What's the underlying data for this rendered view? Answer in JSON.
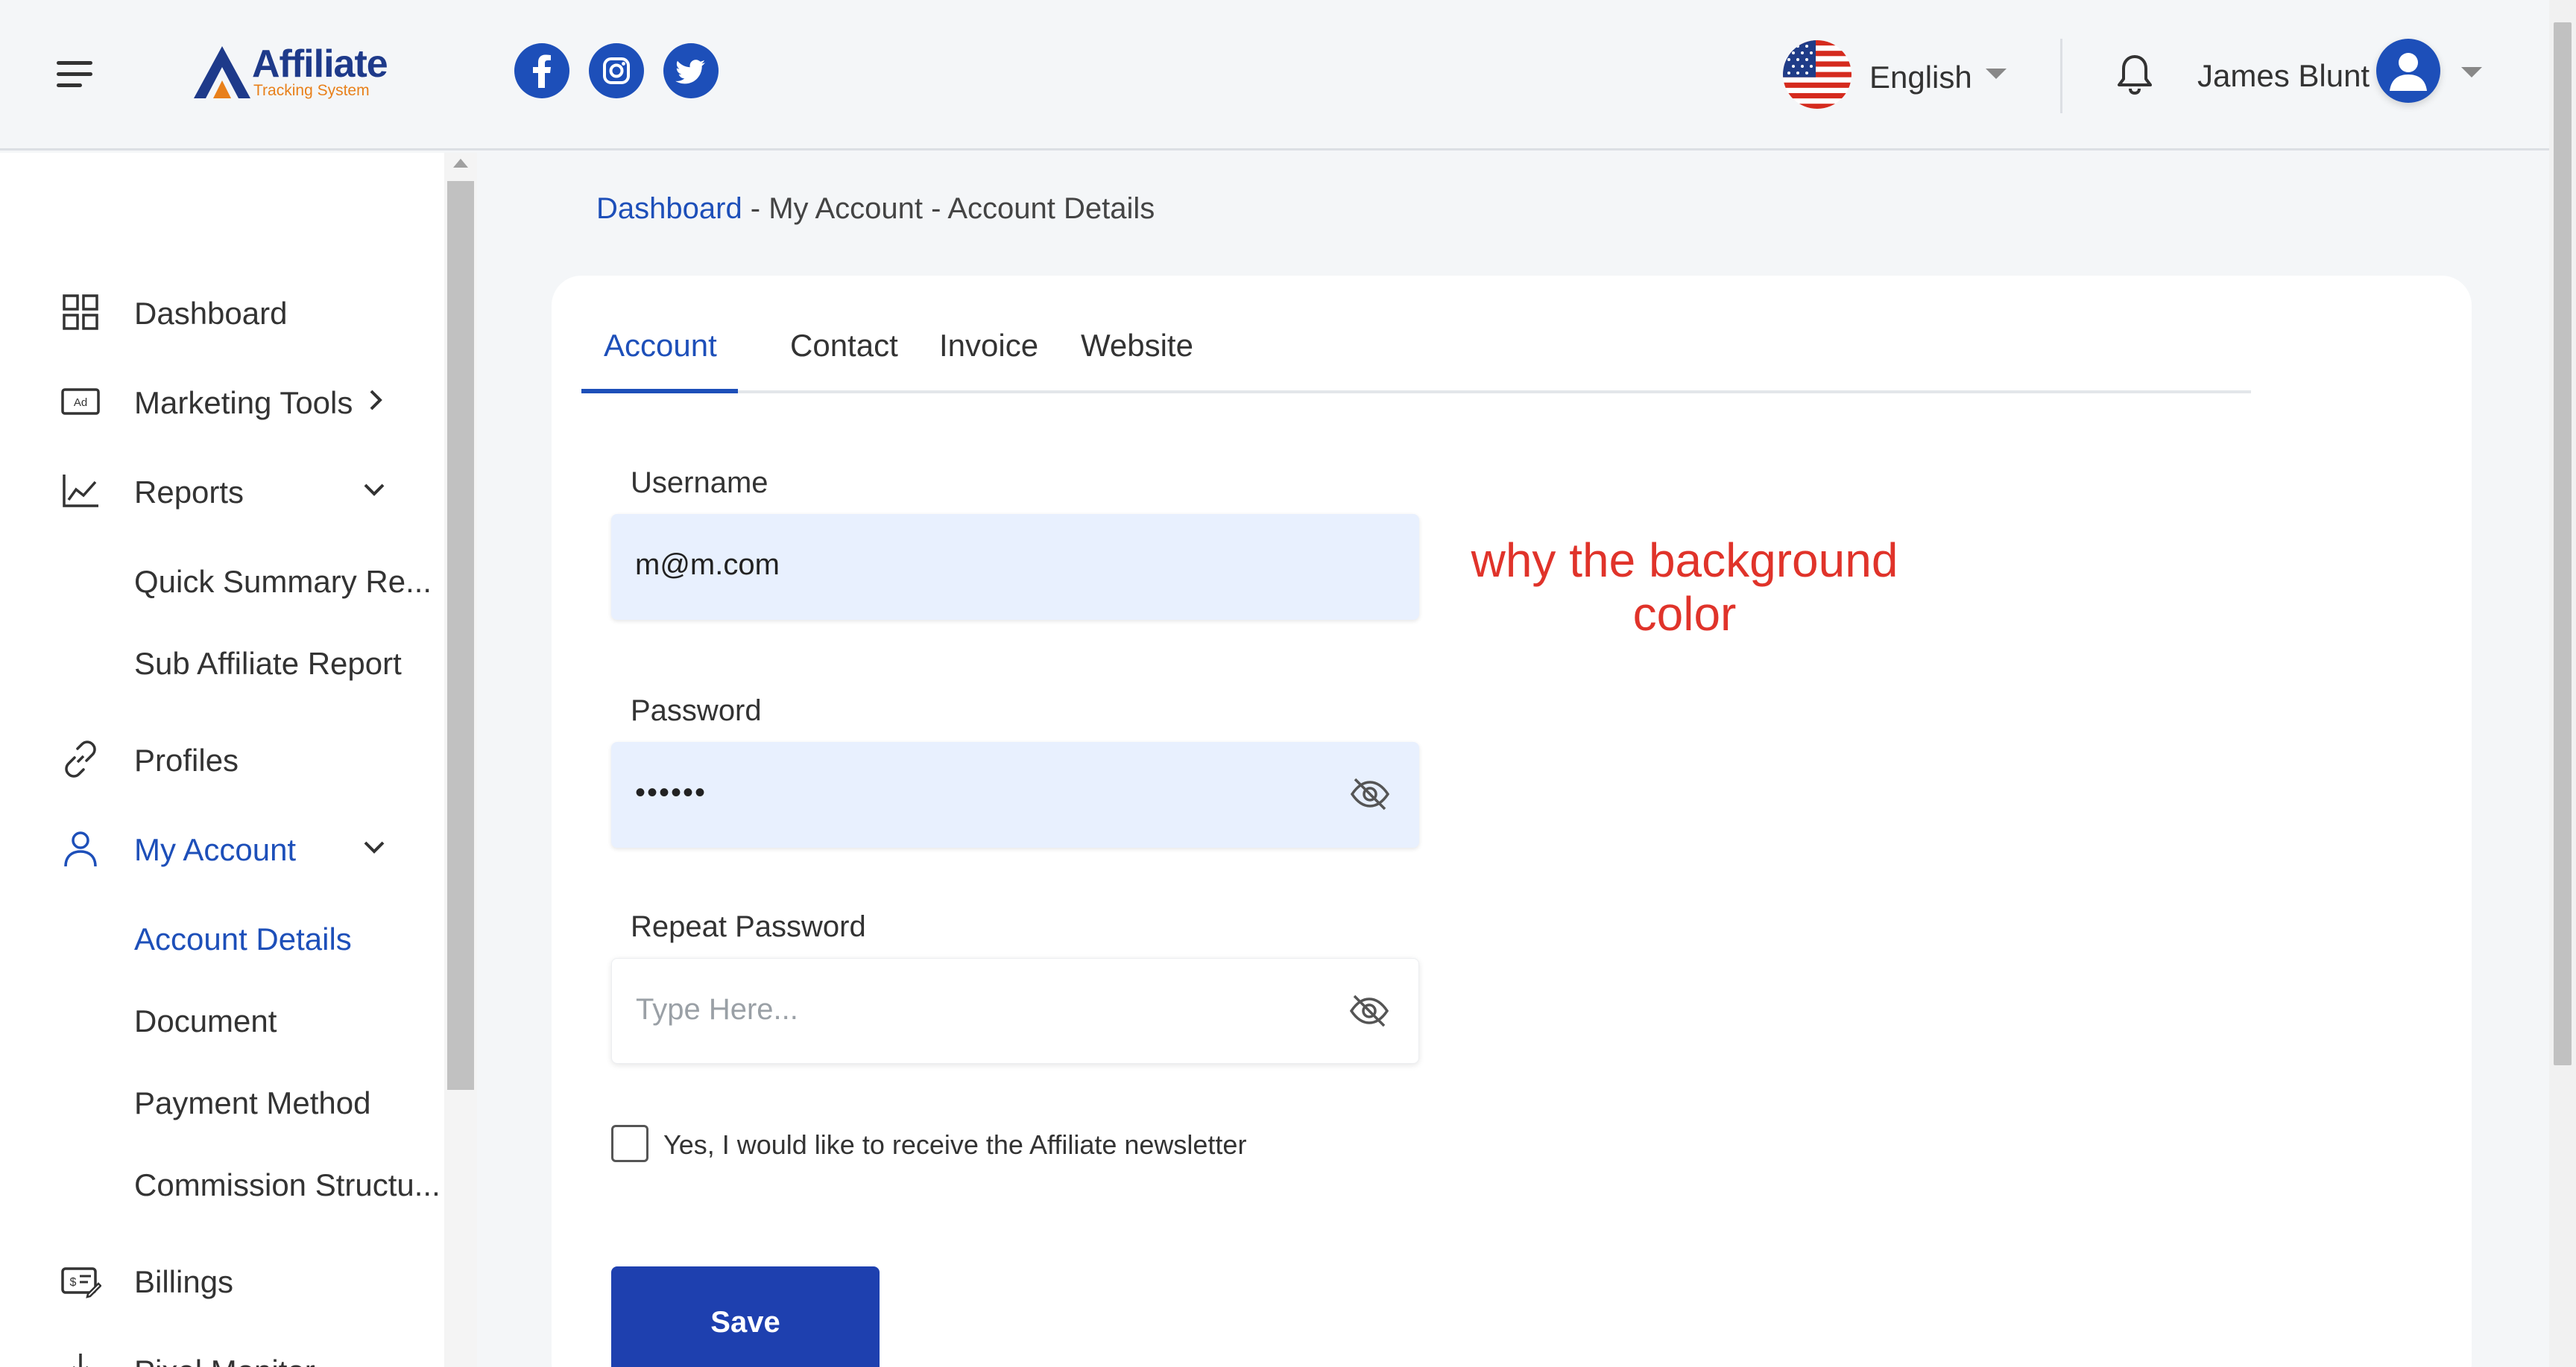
{
  "header": {
    "logo_title": "Affiliate",
    "logo_subtitle": "Tracking System",
    "social": [
      "facebook-icon",
      "instagram-icon",
      "twitter-icon"
    ],
    "language": "English",
    "user_name": "James Blunt"
  },
  "sidebar": {
    "items": [
      {
        "label": "Dashboard",
        "icon": "grid-icon"
      },
      {
        "label": "Marketing Tools",
        "icon": "ad-icon"
      },
      {
        "label": "Reports",
        "icon": "chart-line-icon"
      },
      {
        "label": "Quick Summary Re..."
      },
      {
        "label": "Sub Affiliate Report"
      },
      {
        "label": "Profiles",
        "icon": "link-icon"
      },
      {
        "label": "My Account",
        "icon": "user-icon"
      },
      {
        "label": "Account Details"
      },
      {
        "label": "Document"
      },
      {
        "label": "Payment Method"
      },
      {
        "label": "Commission Structu..."
      },
      {
        "label": "Billings",
        "icon": "billing-icon"
      },
      {
        "label": "Pixel Monitor",
        "icon": "download-icon"
      }
    ]
  },
  "breadcrumb": {
    "link": "Dashboard",
    "rest": " - My Account - Account Details"
  },
  "tabs": [
    "Account",
    "Contact",
    "Invoice",
    "Website"
  ],
  "form": {
    "username_label": "Username",
    "username_value": "m@m.com",
    "password_label": "Password",
    "password_value": "••••••",
    "repeat_label": "Repeat Password",
    "repeat_placeholder": "Type Here...",
    "newsletter_label": "Yes, I would like to receive the Affiliate newsletter",
    "save_label": "Save"
  },
  "annotation": {
    "line1": "why the background",
    "line2": "color"
  },
  "colors": {
    "accent": "#1d4fb9",
    "autofill_bg": "#e8f0fe",
    "annotation": "#e0332a"
  }
}
